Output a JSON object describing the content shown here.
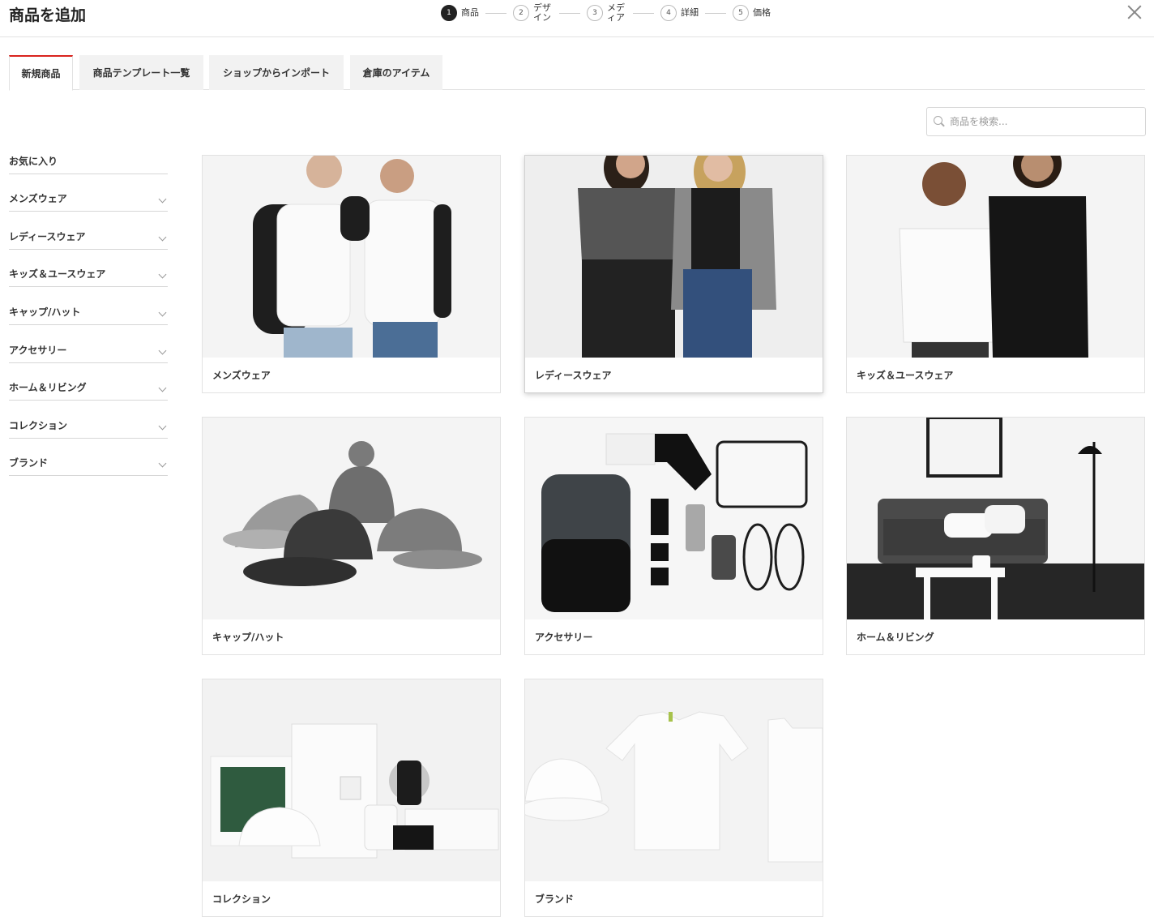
{
  "header": {
    "title": "商品を追加",
    "steps": [
      {
        "num": "1",
        "label": "商品"
      },
      {
        "num": "2",
        "label": "デザイン"
      },
      {
        "num": "3",
        "label": "メディア"
      },
      {
        "num": "4",
        "label": "詳細"
      },
      {
        "num": "5",
        "label": "価格"
      }
    ],
    "active_step": 1
  },
  "tabs": [
    {
      "label": "新規商品"
    },
    {
      "label": "商品テンプレート一覧"
    },
    {
      "label": "ショップからインポート"
    },
    {
      "label": "倉庫のアイテム"
    }
  ],
  "search": {
    "placeholder": "商品を検索..."
  },
  "sidebar": {
    "items": [
      {
        "label": "お気に入り"
      },
      {
        "label": "メンズウェア"
      },
      {
        "label": "レディースウェア"
      },
      {
        "label": "キッズ＆ユースウェア"
      },
      {
        "label": "キャップ/ハット"
      },
      {
        "label": "アクセサリー"
      },
      {
        "label": "ホーム＆リビング"
      },
      {
        "label": "コレクション"
      },
      {
        "label": "ブランド"
      }
    ]
  },
  "categories": [
    {
      "label": "メンズウェア"
    },
    {
      "label": "レディースウェア"
    },
    {
      "label": "キッズ＆ユースウェア"
    },
    {
      "label": "キャップ/ハット"
    },
    {
      "label": "アクセサリー"
    },
    {
      "label": "ホーム＆リビング"
    },
    {
      "label": "コレクション"
    },
    {
      "label": "ブランド"
    }
  ],
  "colors": {
    "accent": "#d9231e",
    "border": "#e2e2e2",
    "text": "#222222"
  }
}
